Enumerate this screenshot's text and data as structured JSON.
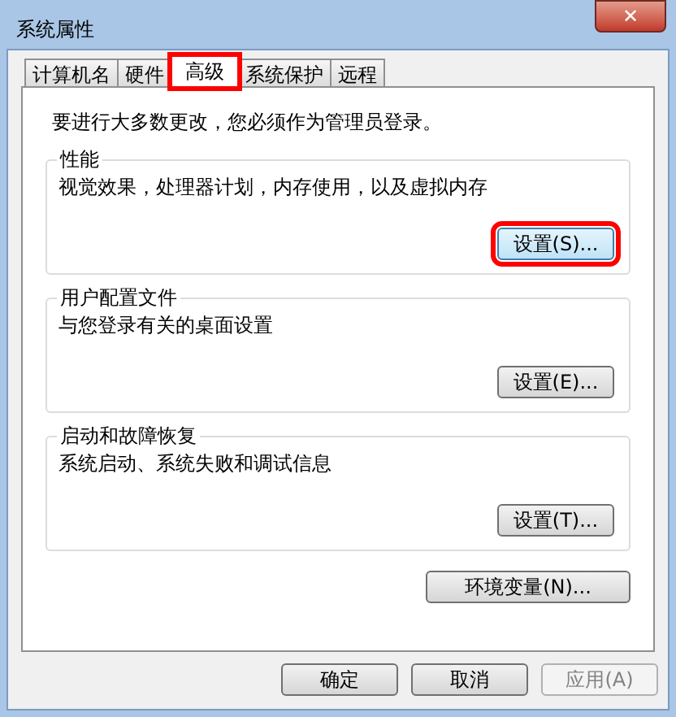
{
  "window": {
    "title": "系统属性",
    "close": "✕"
  },
  "tabs": [
    {
      "label": "计算机名",
      "selected": false,
      "highlighted": false
    },
    {
      "label": "硬件",
      "selected": false,
      "highlighted": false
    },
    {
      "label": "高级",
      "selected": true,
      "highlighted": true
    },
    {
      "label": "系统保护",
      "selected": false,
      "highlighted": false
    },
    {
      "label": "远程",
      "selected": false,
      "highlighted": false
    }
  ],
  "notice": "要进行大多数更改，您必须作为管理员登录。",
  "groups": [
    {
      "title": "性能",
      "description": "视觉效果，处理器计划，内存使用，以及虚拟内存",
      "button": {
        "label": "设置(S)...",
        "highlighted": true,
        "focused": true
      }
    },
    {
      "title": "用户配置文件",
      "description": "与您登录有关的桌面设置",
      "button": {
        "label": "设置(E)...",
        "highlighted": false,
        "focused": false
      }
    },
    {
      "title": "启动和故障恢复",
      "description": "系统启动、系统失败和调试信息",
      "button": {
        "label": "设置(T)...",
        "highlighted": false,
        "focused": false
      }
    }
  ],
  "env_button": {
    "label": "环境变量(N)..."
  },
  "footer_buttons": [
    {
      "label": "确定",
      "disabled": false
    },
    {
      "label": "取消",
      "disabled": false
    },
    {
      "label": "应用(A)",
      "disabled": true
    }
  ]
}
